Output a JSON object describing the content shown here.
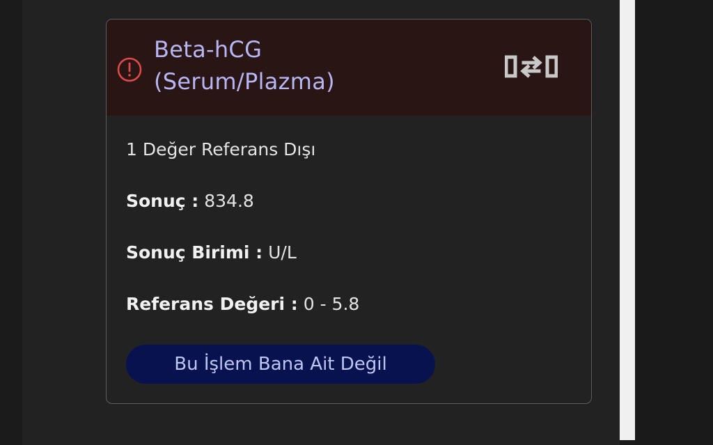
{
  "card": {
    "title_line1": "Beta-hCG",
    "title_line2": "(Serum/Plazma)",
    "status_icon": "alert-circle-icon",
    "action_icon": "compare-arrows-icon",
    "summary": "1 Değer Referans Dışı",
    "fields": {
      "result": {
        "label": "Sonuç :",
        "value": "834.8"
      },
      "unit": {
        "label": "Sonuç Birimi :",
        "value": "U/L"
      },
      "reference": {
        "label": "Referans Değeri :",
        "value": "0 - 5.8"
      }
    },
    "button_label": "Bu İşlem Bana Ait Değil"
  },
  "colors": {
    "header_background": "#2a1515",
    "title_color": "#b7b7f5",
    "alert_color": "#e34b4b",
    "button_background": "#08124f",
    "button_text": "#c0c6f3"
  }
}
